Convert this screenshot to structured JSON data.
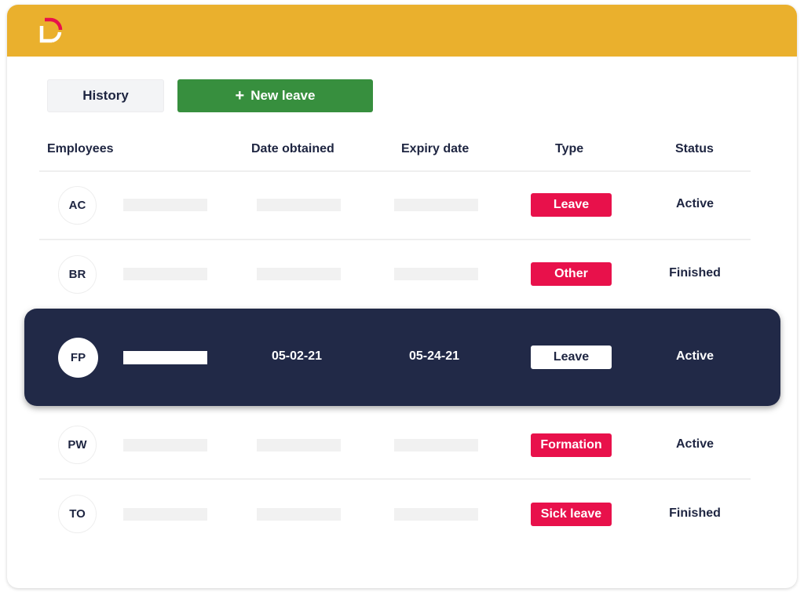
{
  "app": {
    "brand_colors": {
      "header": "#eab02d",
      "accent_red": "#e8114b",
      "primary_green": "#378f3e",
      "dark_navy": "#212947"
    },
    "logo_icon": "letter-d-logo-icon"
  },
  "toolbar": {
    "history_label": "History",
    "new_leave_icon": "plus-icon",
    "new_leave_plus": "+",
    "new_leave_label": "New leave"
  },
  "table": {
    "headers": [
      "Employees",
      "Date obtained",
      "Expiry date",
      "Type",
      "Status"
    ],
    "rows": [
      {
        "initials": "AC",
        "date_obtained": "",
        "expiry_date": "",
        "type": "Leave",
        "status": "Active",
        "selected": false
      },
      {
        "initials": "BR",
        "date_obtained": "",
        "expiry_date": "",
        "type": "Other",
        "status": "Finished",
        "selected": false
      },
      {
        "initials": "FP",
        "date_obtained": "05-02-21",
        "expiry_date": "05-24-21",
        "type": "Leave",
        "status": "Active",
        "selected": true
      },
      {
        "initials": "PW",
        "date_obtained": "",
        "expiry_date": "",
        "type": "Formation",
        "status": "Active",
        "selected": false
      },
      {
        "initials": "TO",
        "date_obtained": "",
        "expiry_date": "",
        "type": "Sick leave",
        "status": "Finished",
        "selected": false
      }
    ]
  }
}
